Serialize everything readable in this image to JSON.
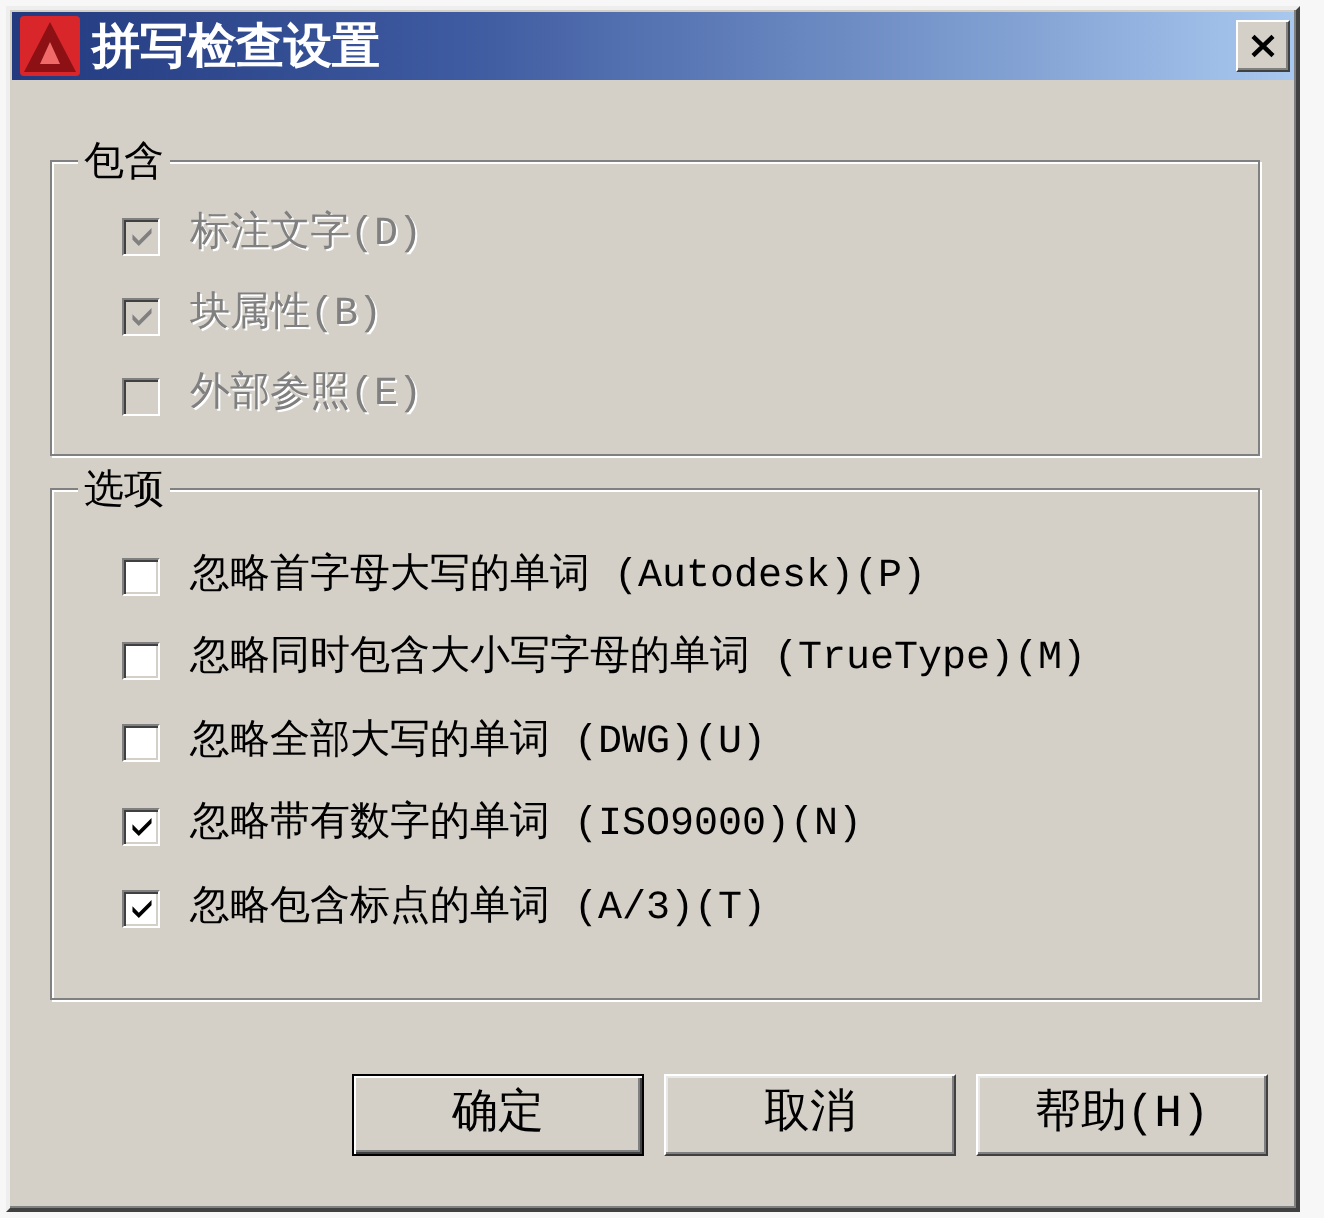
{
  "window": {
    "title": "拼写检查设置"
  },
  "groups": [
    {
      "title": "包含",
      "items": [
        {
          "label": "标注文字(D)",
          "checked": true,
          "disabled": true
        },
        {
          "label": "块属性(B)",
          "checked": true,
          "disabled": true
        },
        {
          "label": "外部参照(E)",
          "checked": false,
          "disabled": true
        }
      ]
    },
    {
      "title": "选项",
      "items": [
        {
          "label": "忽略首字母大写的单词 (Autodesk)(P)",
          "checked": false,
          "disabled": false
        },
        {
          "label": "忽略同时包含大小写字母的单词 (TrueType)(M)",
          "checked": false,
          "disabled": false
        },
        {
          "label": "忽略全部大写的单词 (DWG)(U)",
          "checked": false,
          "disabled": false
        },
        {
          "label": "忽略带有数字的单词 (ISO9000)(N)",
          "checked": true,
          "disabled": false
        },
        {
          "label": "忽略包含标点的单词 (A/3)(T)",
          "checked": true,
          "disabled": false
        }
      ]
    }
  ],
  "buttons": [
    {
      "label": "确定",
      "default": true
    },
    {
      "label": "取消",
      "default": false
    },
    {
      "label": "帮助(H)",
      "default": false
    }
  ]
}
